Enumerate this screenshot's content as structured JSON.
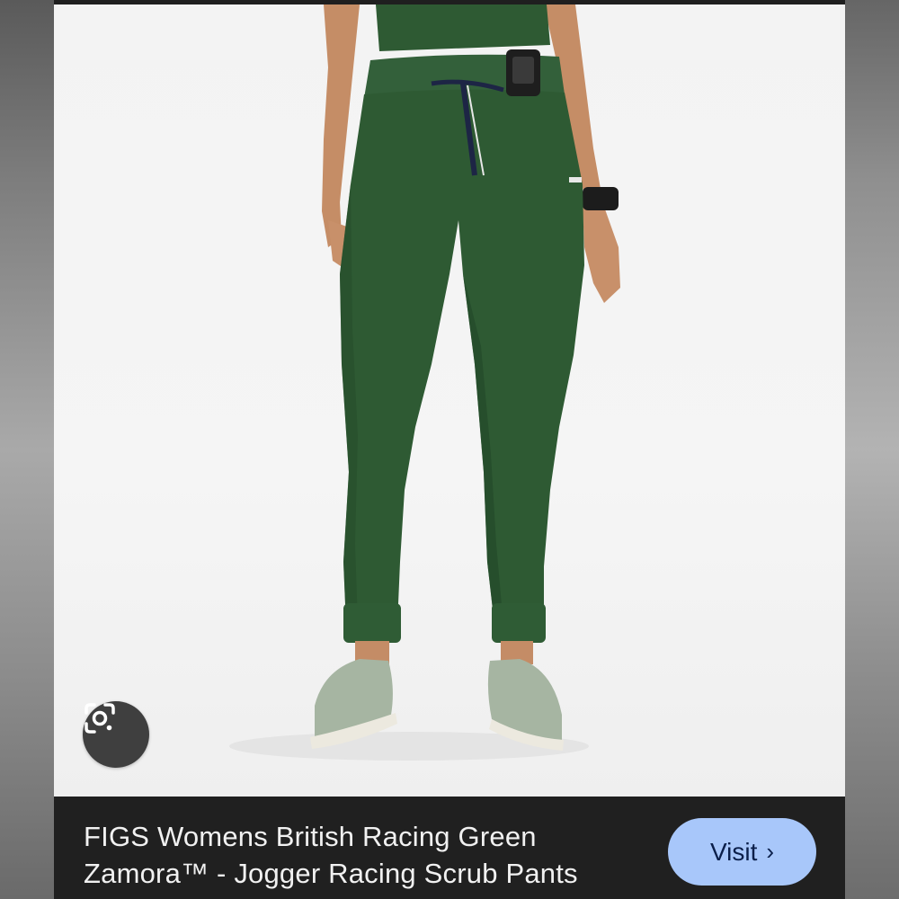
{
  "result": {
    "title_line_1": "FIGS Womens British Racing Green",
    "title_line_2": "Zamora™ - Jogger Racing Scrub Pants",
    "visit_label": "Visit",
    "visit_icon": "chevron-right-icon",
    "visit_chevron": "›"
  },
  "product_image": {
    "subject": "green jogger scrub pants worn by a model",
    "garment_color": "#2e5a33",
    "background_color": "#f3f3f3"
  },
  "lens": {
    "icon": "google-lens-icon"
  },
  "colors": {
    "caption_background": "#202020",
    "caption_text": "#f1f1f1",
    "visit_button_background": "#a8c7fa",
    "visit_button_text": "#0b1f4a"
  }
}
